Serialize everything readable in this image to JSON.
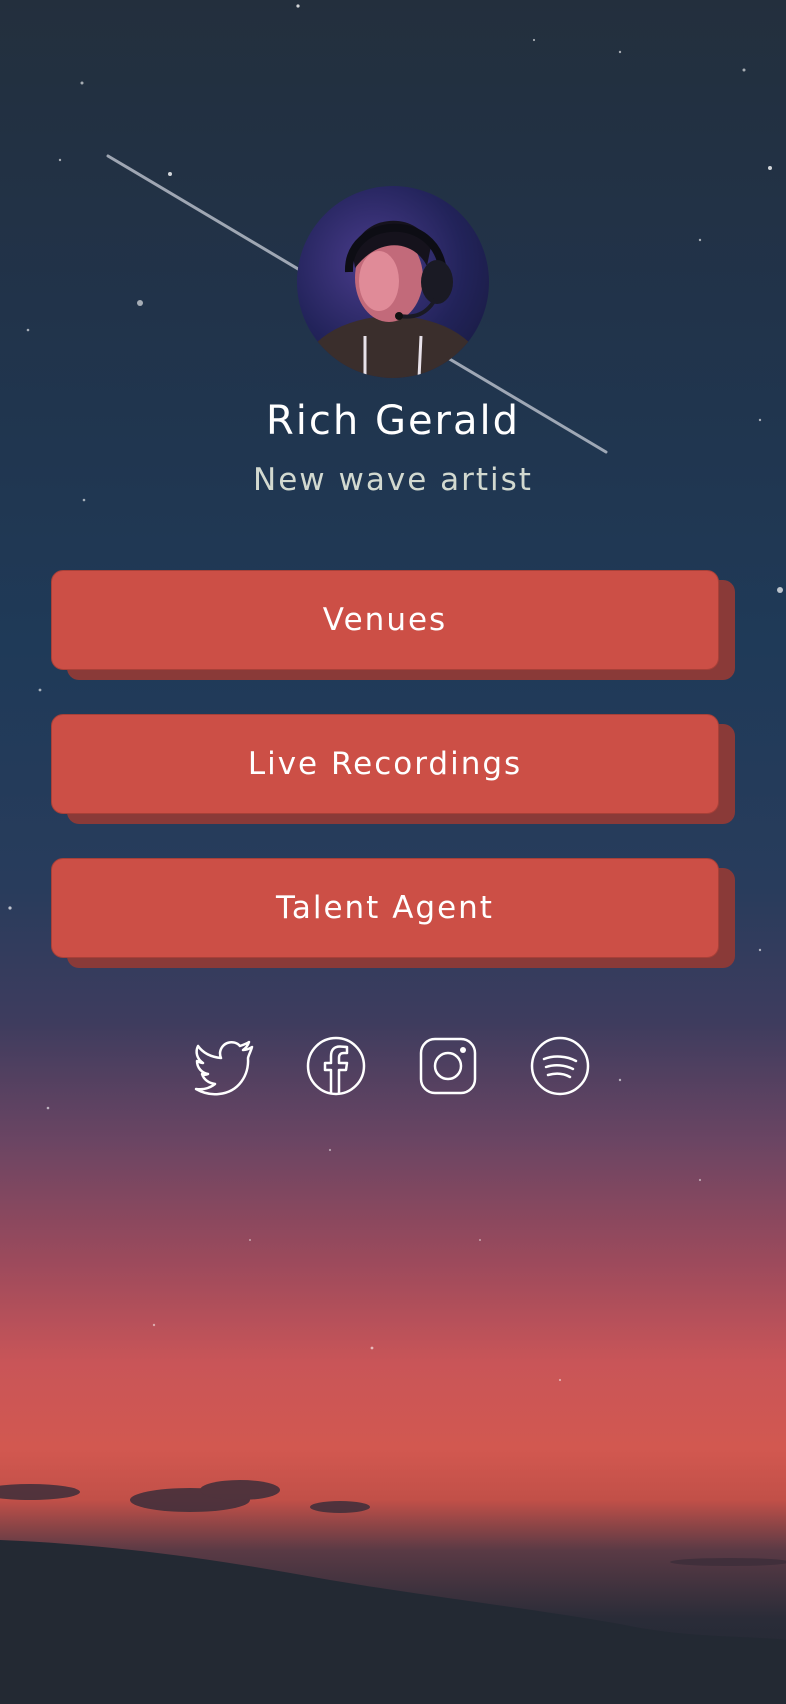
{
  "profile": {
    "name": "Rich Gerald",
    "tagline": "New wave artist"
  },
  "links": [
    {
      "label": "Venues"
    },
    {
      "label": "Live Recordings"
    },
    {
      "label": "Talent Agent"
    }
  ],
  "socials": [
    {
      "icon": "twitter-icon"
    },
    {
      "icon": "facebook-icon"
    },
    {
      "icon": "instagram-icon"
    },
    {
      "icon": "spotify-icon"
    }
  ],
  "colors": {
    "button": "#cc4f46",
    "button_shadow": "#8a3a38",
    "text": "#ffffff",
    "tagline": "#d2d9d0"
  }
}
